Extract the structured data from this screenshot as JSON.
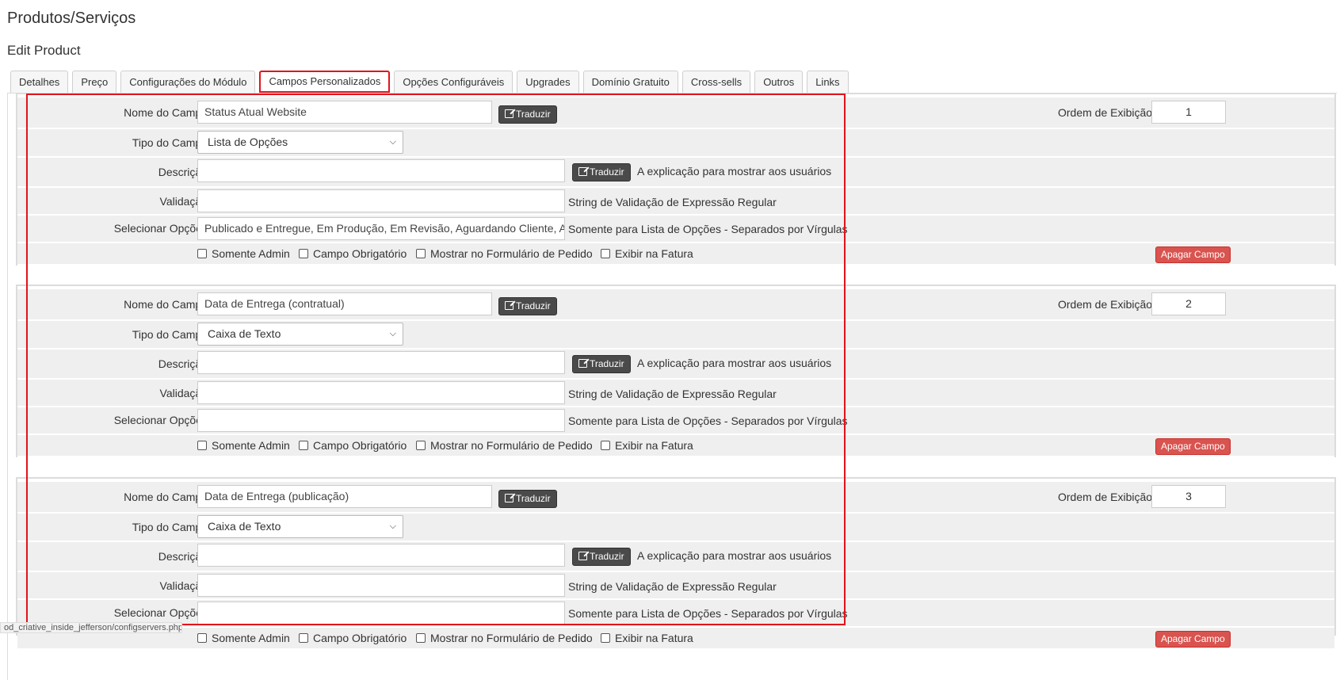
{
  "header": {
    "title": "Produtos/Serviços",
    "subtitle": "Edit Product"
  },
  "tabs": [
    {
      "label": "Detalhes"
    },
    {
      "label": "Preço"
    },
    {
      "label": "Configurações do Módulo"
    },
    {
      "label": "Campos Personalizados",
      "active": true
    },
    {
      "label": "Opções Configuráveis"
    },
    {
      "label": "Upgrades"
    },
    {
      "label": "Domínio Gratuito"
    },
    {
      "label": "Cross-sells"
    },
    {
      "label": "Outros"
    },
    {
      "label": "Links"
    }
  ],
  "labels": {
    "field_name": "Nome do Campo",
    "field_type": "Tipo do Campo",
    "description": "Descrição",
    "validation": "Validação",
    "select_options": "Selecionar Opções",
    "display_order": "Ordem de Exibição",
    "translate": "Traduzir",
    "description_hint": "A explicação para mostrar aos usuários",
    "validation_hint": "String de Validação de Expressão Regular",
    "options_hint": "Somente para Lista de Opções - Separados por Vírgulas",
    "admin_only": "Somente Admin",
    "required": "Campo Obrigatório",
    "show_on_order": "Mostrar no Formulário de Pedido",
    "show_on_invoice": "Exibir na Fatura",
    "delete_field": "Apagar Campo"
  },
  "fields": [
    {
      "name": "Status Atual Website",
      "type": "Lista de Opções",
      "description": "",
      "validation": "",
      "options": "Publicado e Entregue, Em Produção, Em Revisão, Aguardando Cliente, Agu",
      "order": "1"
    },
    {
      "name": "Data de Entrega (contratual)",
      "type": "Caixa de Texto",
      "description": "",
      "validation": "",
      "options": "",
      "order": "2"
    },
    {
      "name": "Data de Entrega (publicação)",
      "type": "Caixa de Texto",
      "description": "",
      "validation": "",
      "options": "",
      "order": "3"
    }
  ],
  "status_bar": {
    "url": "od_criative_inside_jefferson/configservers.php"
  },
  "colors": {
    "highlight": "#e3131b",
    "delete_button": "#d9534f",
    "translate_button": "#4a4a4a",
    "row_background": "#efefef"
  }
}
